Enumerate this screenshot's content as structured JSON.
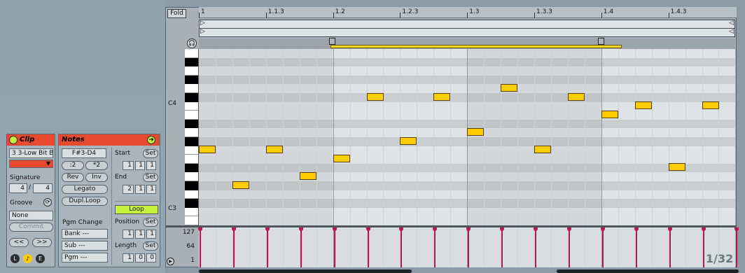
{
  "clip": {
    "title": "Clip",
    "name": "3 3-Low Bit B",
    "signature_label": "Signature",
    "sig_num": "4",
    "sig_sep": "/",
    "sig_den": "4",
    "groove_label": "Groove",
    "groove_value": "None",
    "commit_label": "Commit",
    "nudge_back": "<<",
    "nudge_fwd": ">>",
    "footer": [
      "L",
      "E"
    ]
  },
  "notes": {
    "title": "Notes",
    "range": "F#3-D4",
    "half": ":2",
    "double": "*2",
    "rev": "Rev",
    "inv": "Inv",
    "legato": "Legato",
    "dupl_loop": "Dupl.Loop",
    "pgm_change_label": "Pgm Change",
    "bank": "Bank ---",
    "sub": "Sub ---",
    "pgm": "Pgm ---"
  },
  "loop_panel": {
    "start_label": "Start",
    "end_label": "End",
    "set_label": "Set",
    "start": [
      "1",
      "1",
      "1"
    ],
    "end": [
      "2",
      "1",
      "1"
    ],
    "loop_label": "Loop",
    "position_label": "Position",
    "position": [
      "1",
      "1",
      "1"
    ],
    "length_label": "Length",
    "length": [
      "1",
      "0",
      "0"
    ]
  },
  "editor": {
    "fold_label": "Fold",
    "ruler": [
      "1",
      "1.1.3",
      "1.2",
      "1.2.3",
      "1.3",
      "1.3.3",
      "1.4",
      "1.4.3"
    ],
    "key_labels": [
      "C4",
      "C3"
    ],
    "velocity_labels": [
      "127",
      "64",
      "1"
    ],
    "grid_readout": "1/32"
  },
  "colors": {
    "note_fill": "#ffcc00",
    "clip_header": "#e84a30",
    "loop_active": "#c5f23a",
    "velocity": "#c0144e"
  },
  "note_pitch_rows": [
    11,
    15,
    11,
    14,
    12,
    5,
    10,
    5,
    9,
    4,
    11,
    5,
    7,
    6,
    13,
    6,
    9
  ]
}
